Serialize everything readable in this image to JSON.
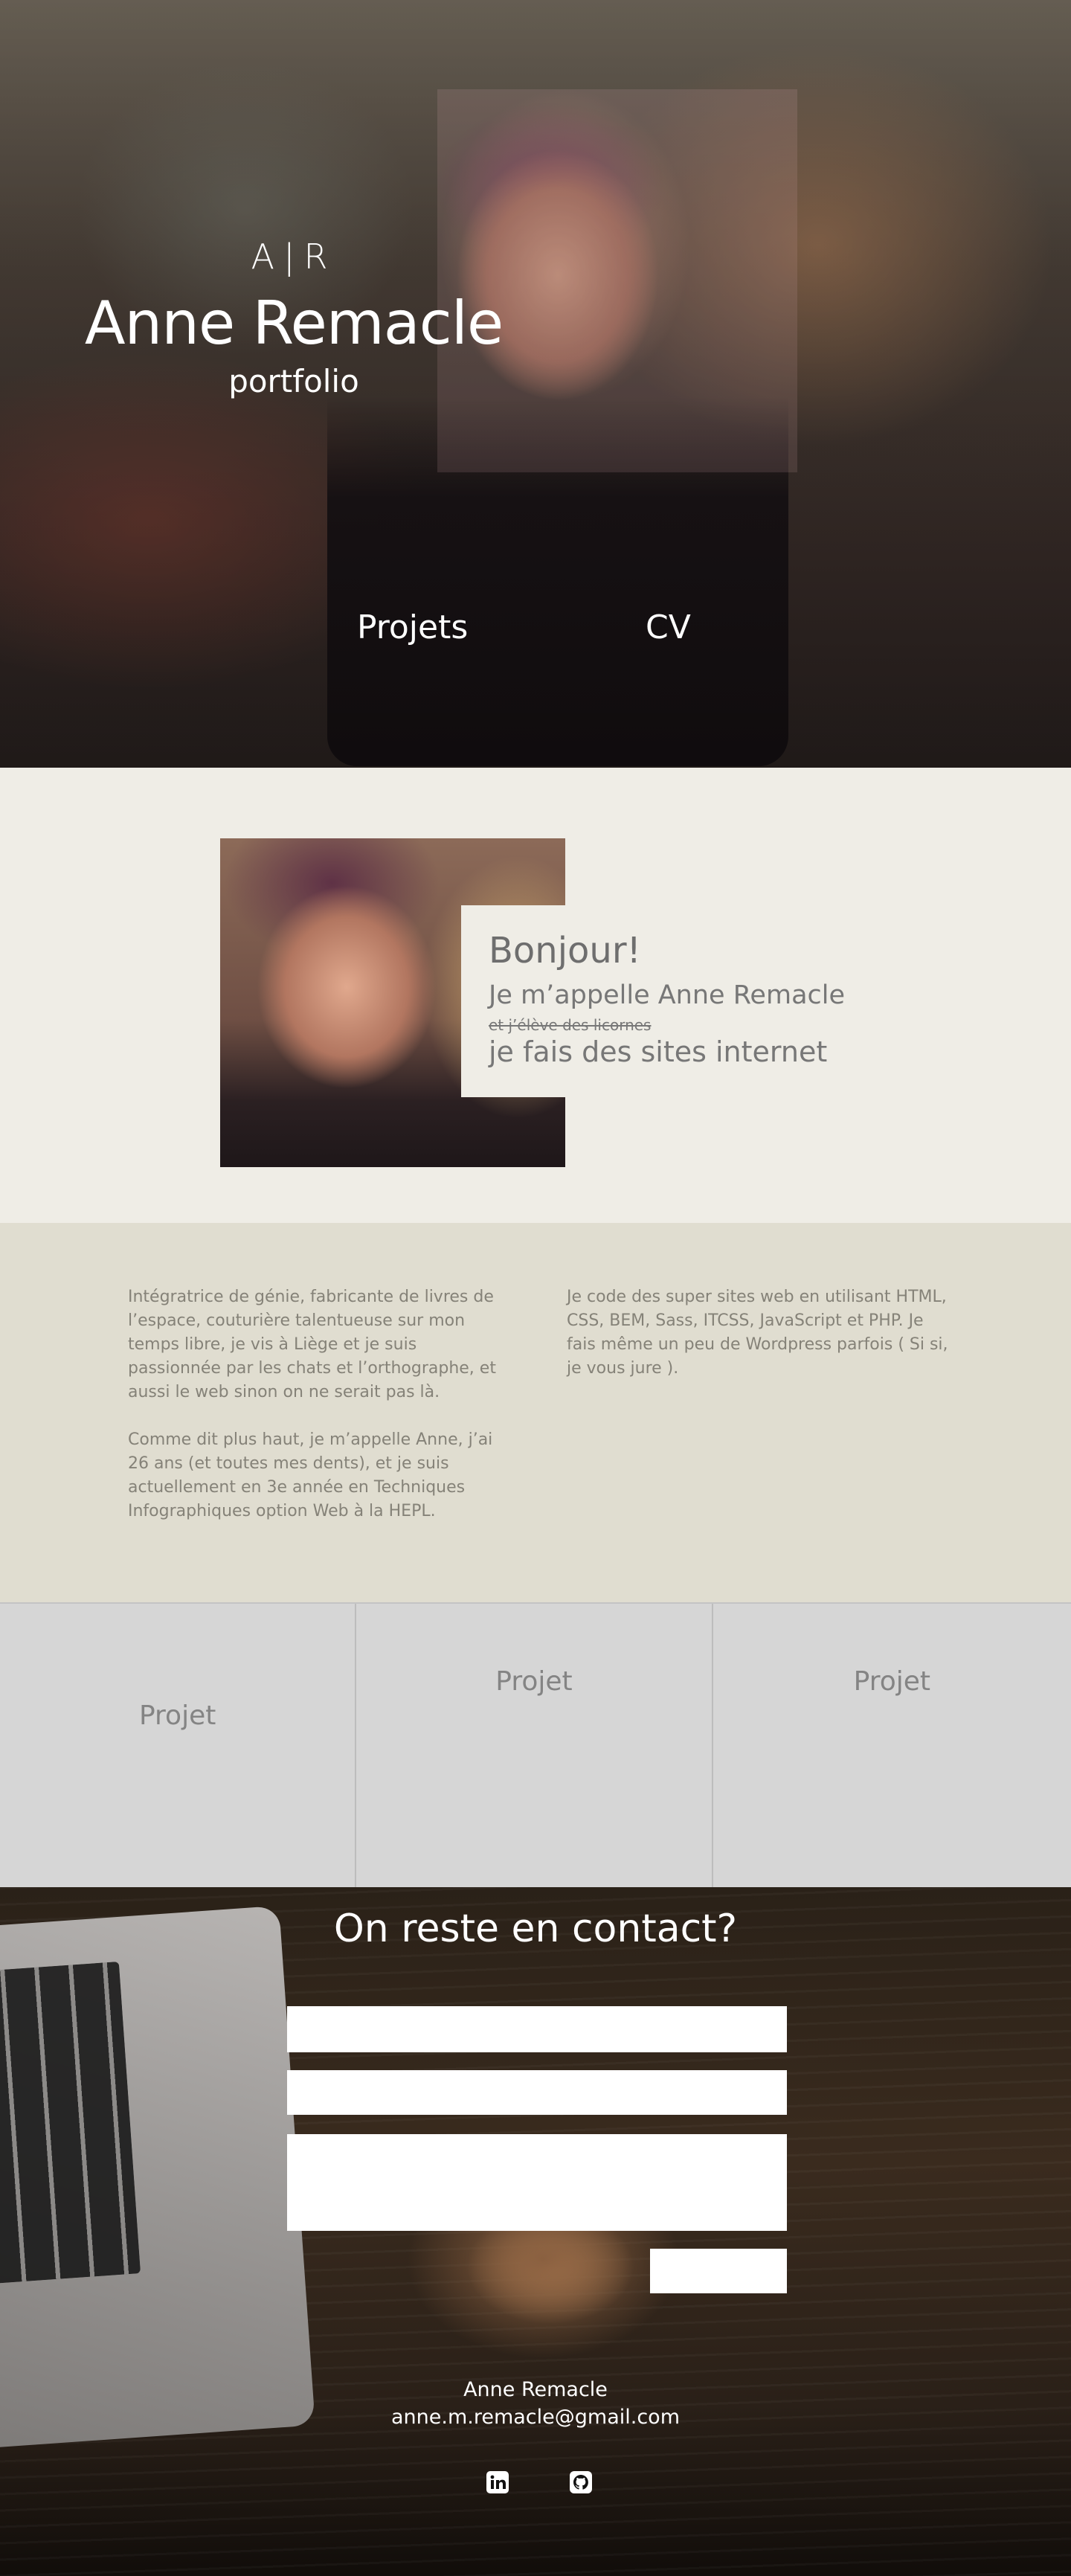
{
  "hero": {
    "logo_initials": "A|R",
    "name": "Anne Remacle",
    "subtitle": "portfolio",
    "nav": [
      "Projets",
      "CV"
    ]
  },
  "intro": {
    "greeting": "Bonjour!",
    "name_line": "Je m’appelle Anne Remacle",
    "strike_line": "et j’élève des licornes",
    "job_line": "je fais des sites internet"
  },
  "about": {
    "p1": "Intégratrice de génie, fabricante de livres de l’espace, couturière talentueuse sur mon temps libre, je vis à Liège et je suis passionnée par les chats et l’orthographe, et aussi le web sinon on ne serait pas là.",
    "p2": "Comme dit plus haut, je m’appelle Anne, j’ai 26 ans (et toutes mes dents), et je suis actuellement en 3e année en Techniques Infographiques option Web à la HEPL.",
    "p3": "Je code des super sites web en utilisant HTML, CSS, BEM, Sass, ITCSS, JavaScript et PHP. Je fais même un peu de Wordpress parfois ( Si si, je vous jure )."
  },
  "projects": [
    "Projet",
    "Projet",
    "Projet"
  ],
  "contact": {
    "title": "On reste en contact?",
    "footer_name": "Anne Remacle",
    "footer_email": "anne.m.remacle@gmail.com",
    "social_icons": [
      "linkedin-icon",
      "github-icon"
    ]
  }
}
